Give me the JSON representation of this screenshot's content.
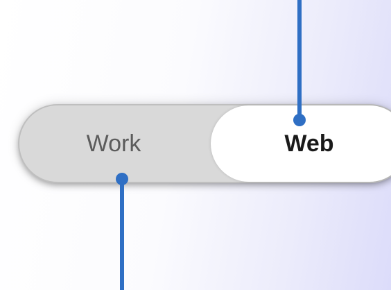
{
  "segmented_control": {
    "options": [
      {
        "label": "Work",
        "selected": false
      },
      {
        "label": "Web",
        "selected": true
      }
    ]
  },
  "callouts": {
    "color": "#2f6fc4"
  },
  "colors": {
    "track": "#d9d9d9",
    "selected_segment": "#ffffff",
    "unselected_text": "#5c5c5c",
    "selected_text": "#1a1a1a"
  }
}
